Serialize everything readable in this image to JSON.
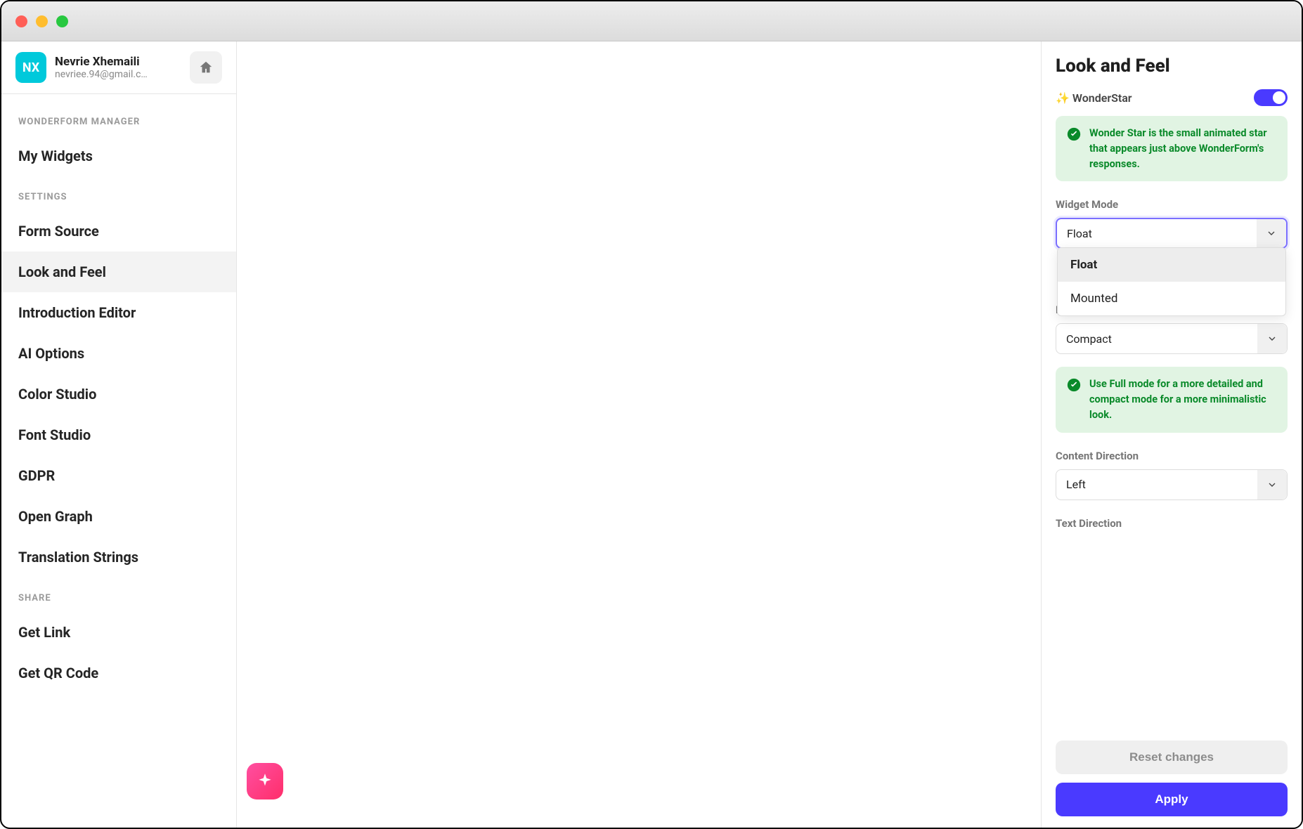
{
  "profile": {
    "initials": "NX",
    "name": "Nevrie Xhemaili",
    "email": "nevriee.94@gmail.c…"
  },
  "sidebar": {
    "section1": "WONDERFORM MANAGER",
    "my_widgets": "My Widgets",
    "section2": "SETTINGS",
    "items": [
      "Form Source",
      "Look and Feel",
      "Introduction Editor",
      "AI Options",
      "Color Studio",
      "Font Studio",
      "GDPR",
      "Open Graph",
      "Translation Strings"
    ],
    "section3": "SHARE",
    "share_items": [
      "Get Link",
      "Get QR Code"
    ]
  },
  "panel": {
    "title": "Look and Feel",
    "wonderstar_label": "✨ WonderStar",
    "wonderstar_desc": "Wonder Star is the small animated star that appears just above WonderForm's responses.",
    "widget_mode_label": "Widget Mode",
    "widget_mode_value": "Float",
    "widget_mode_options": [
      "Float",
      "Mounted"
    ],
    "layout_density_label": "Layout Density",
    "layout_density_value": "Compact",
    "layout_density_desc": "Use Full mode for a more detailed and compact mode for a more minimalistic look.",
    "content_direction_label": "Content Direction",
    "content_direction_value": "Left",
    "text_direction_label": "Text Direction"
  },
  "footer": {
    "reset": "Reset changes",
    "apply": "Apply"
  }
}
